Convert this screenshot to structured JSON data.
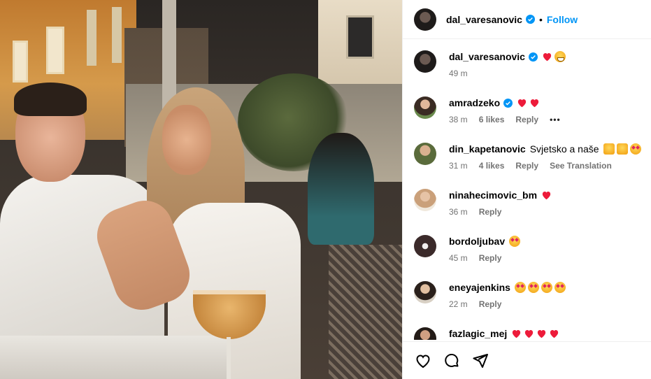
{
  "post": {
    "owner_handle": "dal_varesanovic",
    "separator": "•",
    "follow_label": "Follow"
  },
  "comments": [
    {
      "handle": "dal_varesanovic",
      "text": "",
      "emojis": [
        "red-heart",
        "grinning-face"
      ],
      "time": "49 m",
      "likes": "",
      "reply": "",
      "verified": true
    },
    {
      "handle": "amradzeko",
      "text": "",
      "emojis": [
        "red-heart",
        "red-heart"
      ],
      "time": "38 m",
      "likes": "6 likes",
      "reply": "Reply",
      "more": "•••",
      "verified": true
    },
    {
      "handle": "din_kapetanovic",
      "text": "Svjetsko a naše",
      "emojis": [
        "raising-hands",
        "raising-hands",
        "star-struck"
      ],
      "time": "31 m",
      "likes": "4 likes",
      "reply": "Reply",
      "see_translation": "See Translation"
    },
    {
      "handle": "ninahecimovic_bm",
      "text": "",
      "emojis": [
        "red-heart"
      ],
      "time": "36 m",
      "likes": "",
      "reply": "Reply"
    },
    {
      "handle": "bordoljubav",
      "text": "",
      "emojis": [
        "star-struck"
      ],
      "time": "45 m",
      "likes": "",
      "reply": "Reply"
    },
    {
      "handle": "eneyajenkins",
      "text": "",
      "emojis": [
        "star-struck",
        "star-struck",
        "star-struck",
        "star-struck"
      ],
      "time": "22 m",
      "likes": "",
      "reply": "Reply"
    },
    {
      "handle": "fazlagic_mej",
      "text": "",
      "emojis": [
        "red-heart",
        "red-heart",
        "red-heart",
        "red-heart"
      ],
      "time": "",
      "likes": "",
      "reply": ""
    }
  ],
  "actions": {
    "like_icon": "heart-outline-icon",
    "comment_icon": "comment-bubble-icon",
    "share_icon": "paper-plane-icon"
  },
  "colors": {
    "accent": "#0095f6",
    "heart": "#ed1b3a",
    "meta_text": "#737373",
    "border": "#efefef"
  }
}
